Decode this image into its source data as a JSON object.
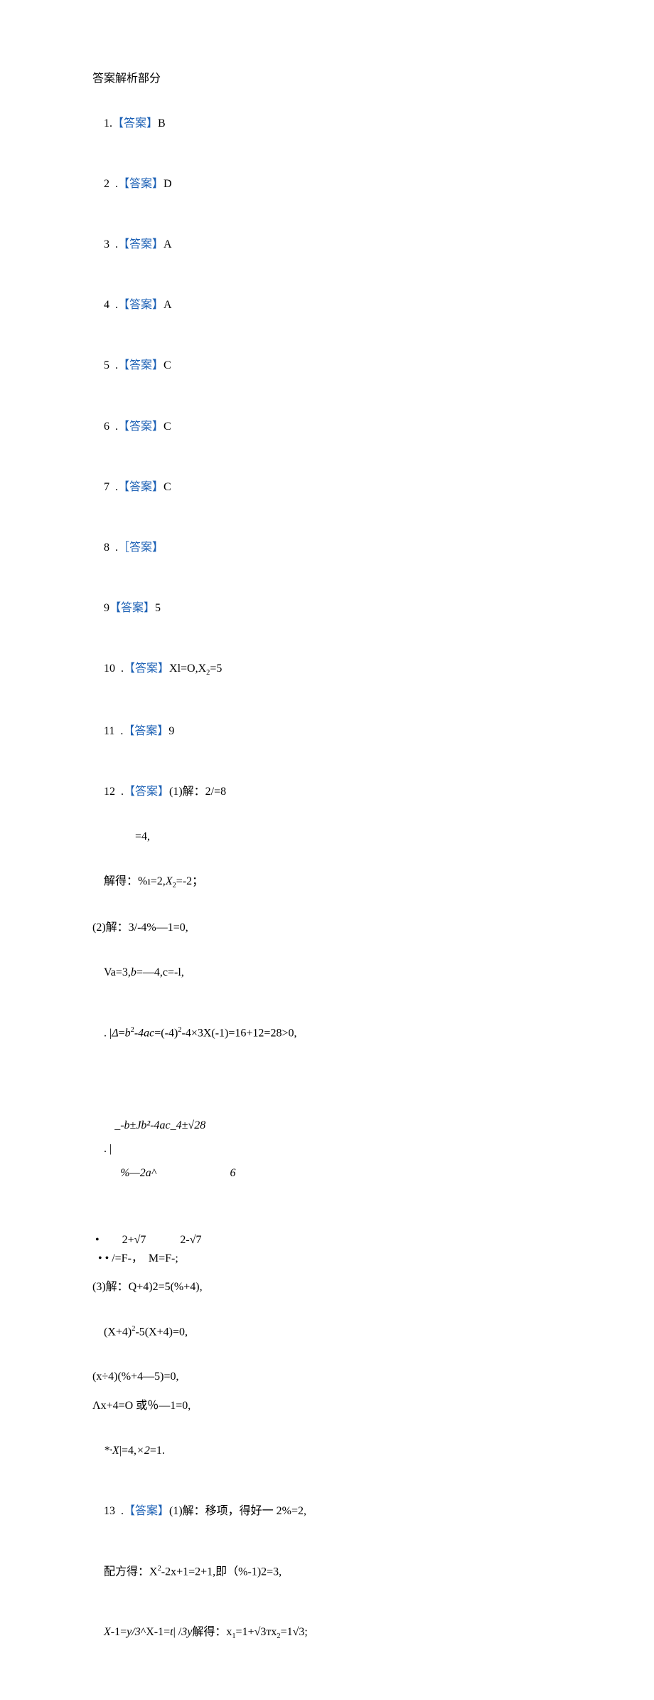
{
  "heading": "答案解析部分",
  "items": {
    "q1_num": "1.",
    "q1_lbl": "【答案】",
    "q1_val": "B",
    "q2_num": "2  .",
    "q2_lbl": "【答案】",
    "q2_val": "D",
    "q3_num": "3  .",
    "q3_lbl": "【答案】",
    "q3_val": "A",
    "q4_num": "4  .",
    "q4_lbl": "【答案】",
    "q4_val": "A",
    "q5_num": "5  .",
    "q5_lbl": "【答案】",
    "q5_val": "C",
    "q6_num": "6  .",
    "q6_lbl": "【答案】",
    "q6_val": "C",
    "q7_num": "7  .",
    "q7_lbl": "【答案】",
    "q7_val": "C",
    "q8_num": "8  .",
    "q8_lbl": "［答案】",
    "q8_val": "",
    "q9_num": "9",
    "q9_lbl": "【答案】",
    "q9_val": "5",
    "q10_num": "10  .",
    "q10_lbl": "【答案】",
    "q10_val_a": "Xl=O,",
    "q10_val_b": "X",
    "q10_val_c": "=5",
    "q11_num": "11  .",
    "q11_lbl": "【答案】",
    "q11_val": "9",
    "q12_num": "12  .",
    "q12_lbl": "【答案】",
    "q12_l1": "(1)解：2/=8",
    "q12_l2": "=4,",
    "q12_l3a": "解得：%ı=2,",
    "q12_l3b": "X",
    "q12_l3c": "=-2；",
    "q12_l4": "(2)解：3/-4%—1=0,",
    "q12_l5a": "Va=3,",
    "q12_l5b": "b",
    "q12_l5c": "=—4,c=-l,",
    "q12_l6a": ". |",
    "q12_l6b": "Δ",
    "q12_l6c": "=",
    "q12_l6d": "b",
    "q12_l6e": "-4ac",
    "q12_l6f": "=(-4)",
    "q12_l6g": "-4×3X(-1)=16+12=28>0,",
    "q12_l7a": ". |",
    "q12_l7_num": "_-b±Jb²-4ac_4±√28",
    "q12_l7_den": "  %—2a^                          6",
    "q12_l8": " •        2+√7            2-√7",
    "q12_l9": "  • • /=F-，  M=F-;",
    "q12_l10": "(3)解：Q+4)2=5(%+4),",
    "q12_l11a": "(X+4)",
    "q12_l11b": "-5(X+4)=0,",
    "q12_l12": "(x÷4)(%+4—5)=0,",
    "q12_l13": "Λx+4=O 或％—1=0,",
    "q12_l14a": "*·X",
    "q12_l14b": "|=4,",
    "q12_l14c": "×2",
    "q12_l14d": "=1.",
    "q13_num": "13  .",
    "q13_lbl": "【答案】",
    "q13_l1": "(1)解：移项，得好一 2%=2,",
    "q13_l2a": "配方得：X",
    "q13_l2b": "-2x+1=2+1,即（%-1)2=3,",
    "q13_l3a": "X",
    "q13_l3b": "-1=",
    "q13_l3c": "y/3",
    "q13_l3d": "^X-1=",
    "q13_l3e": "t",
    "q13_l3f": "| /",
    "q13_l3g": "3y",
    "q13_l3h": "解得：x",
    "q13_l3i": "=1+√3тx",
    "q13_l3j": "=1√3;"
  },
  "sub2": "2",
  "sup2": "2",
  "sub1": "1"
}
